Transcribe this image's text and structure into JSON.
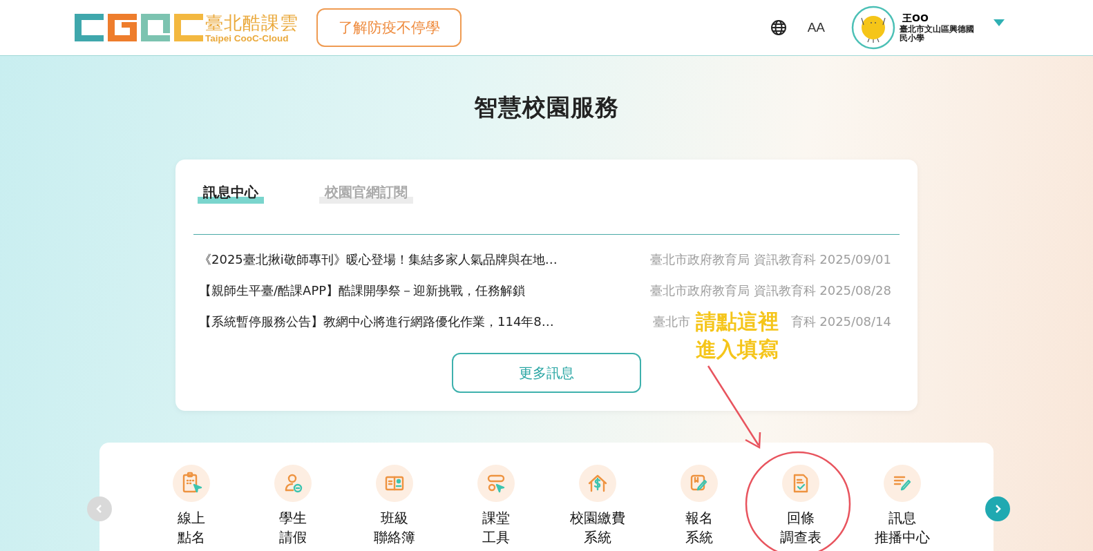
{
  "header": {
    "logo_title": "臺北酷課雲",
    "logo_subtitle": "Taipei CooC-Cloud",
    "promo_button": "了解防疫不停學",
    "font_size_button": "AA",
    "user": {
      "name": "王OO",
      "school": "臺北市文山區興德國民小學"
    }
  },
  "page_title": "智慧校園服務",
  "news": {
    "tabs": [
      {
        "label": "訊息中心",
        "selected": true
      },
      {
        "label": "校園官網訂閱",
        "selected": false
      }
    ],
    "rows": [
      {
        "title": "《2025臺北揪i敬師專刊》暖心登場！集結多家人氣品牌與在地…",
        "source_parts": [
          "臺北市政府教育局 資訊教育科 2025/09/01"
        ]
      },
      {
        "title": "【親師生平臺/酷課APP】酷課開學祭－迎新挑戰，任務解鎖",
        "source_parts": [
          "臺北市政府教育局 資訊教育科 2025/08/28"
        ]
      },
      {
        "title": "【系統暫停服務公告】教網中心將進行網路優化作業，114年8…",
        "source_parts": [
          "臺北市",
          "育科 2025/08/14"
        ]
      }
    ],
    "more_button": "更多訊息"
  },
  "services": [
    {
      "lines": [
        "線上",
        "點名"
      ]
    },
    {
      "lines": [
        "學生",
        "請假"
      ]
    },
    {
      "lines": [
        "班級",
        "聯絡簿"
      ]
    },
    {
      "lines": [
        "課堂",
        "工具"
      ]
    },
    {
      "lines": [
        "校園繳費",
        "系統"
      ]
    },
    {
      "lines": [
        "報名",
        "系統"
      ]
    },
    {
      "lines": [
        "回條",
        "調查表"
      ]
    },
    {
      "lines": [
        "訊息",
        "推播中心"
      ]
    }
  ],
  "annotation": {
    "lines": [
      "請點這裡",
      "進入填寫"
    ]
  }
}
